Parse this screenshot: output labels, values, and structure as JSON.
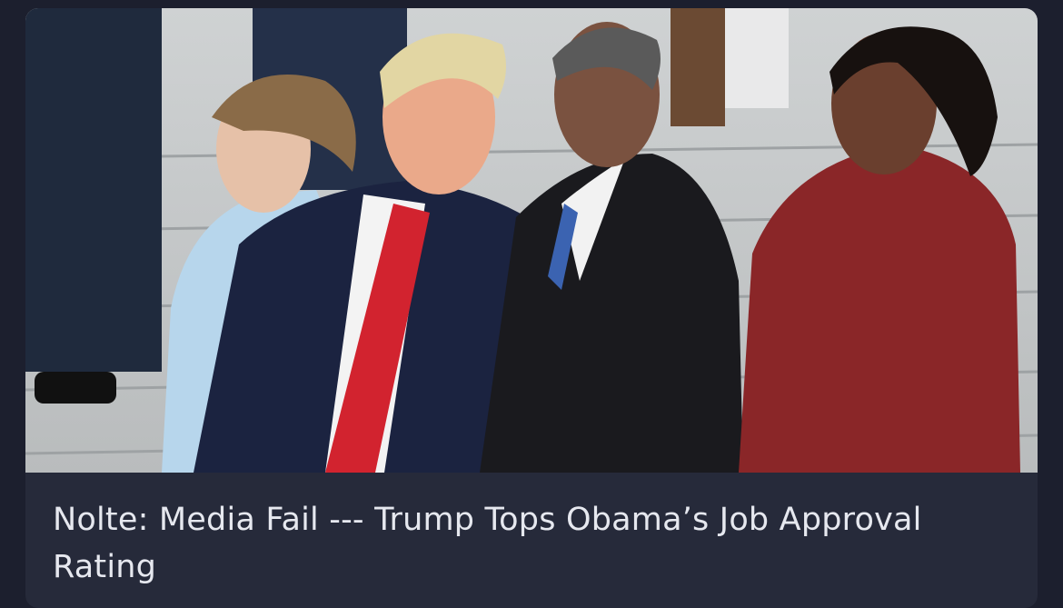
{
  "card": {
    "headline": "Nolte: Media Fail --- Trump Tops Obama’s Job Approval Rating"
  },
  "colors": {
    "page_background": "#1c1f2e",
    "card_background": "#262a3a",
    "headline_text": "#e6e8ef"
  }
}
